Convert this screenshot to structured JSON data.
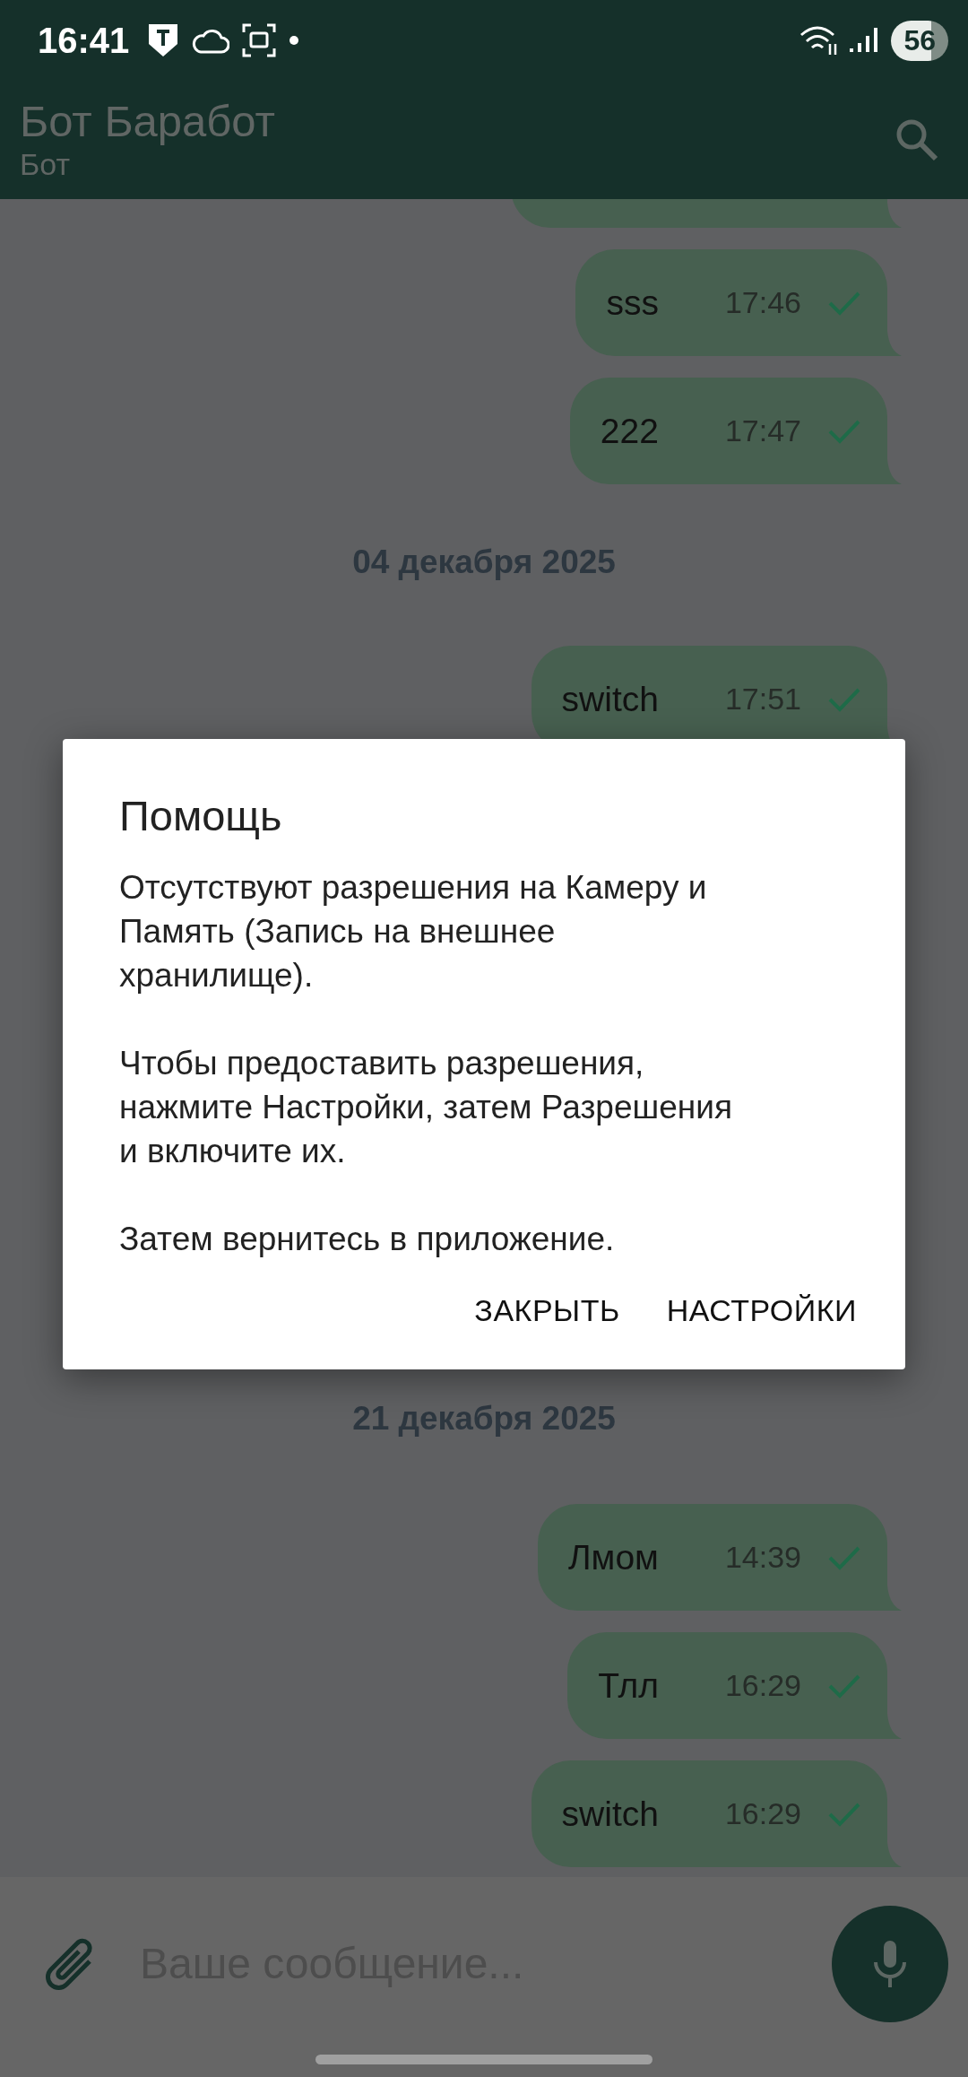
{
  "status_bar": {
    "time": "16:41",
    "battery": "56"
  },
  "app_bar": {
    "title": "Бот Баработ",
    "subtitle": "Бот"
  },
  "chat_top": [
    {
      "kind": "message",
      "text": "sss",
      "time": "17:46"
    },
    {
      "kind": "message",
      "text": "222",
      "time": "17:47"
    },
    {
      "kind": "date",
      "text": "04 декабря 2025"
    },
    {
      "kind": "message",
      "text": "switch",
      "time": "17:51"
    }
  ],
  "chat_bottom": [
    {
      "kind": "date",
      "text": "21 декабря 2025"
    },
    {
      "kind": "message",
      "text": "Лмом",
      "time": "14:39"
    },
    {
      "kind": "message",
      "text": "Тлл",
      "time": "16:29"
    },
    {
      "kind": "message",
      "text": "switch",
      "time": "16:29"
    }
  ],
  "composer": {
    "placeholder": "Ваше сообщение..."
  },
  "dialog": {
    "title": "Помощь",
    "paragraphs": [
      "Отсутствуют разрешения на Камеру и Память (Запись на внешнее хранилище).",
      "Чтобы предоставить разрешения, нажмите Настройки, затем Разрешения и включите их.",
      "Затем вернитесь в приложение."
    ],
    "buttons": [
      "ЗАКРЫТЬ",
      "НАСТРОЙКИ"
    ]
  }
}
